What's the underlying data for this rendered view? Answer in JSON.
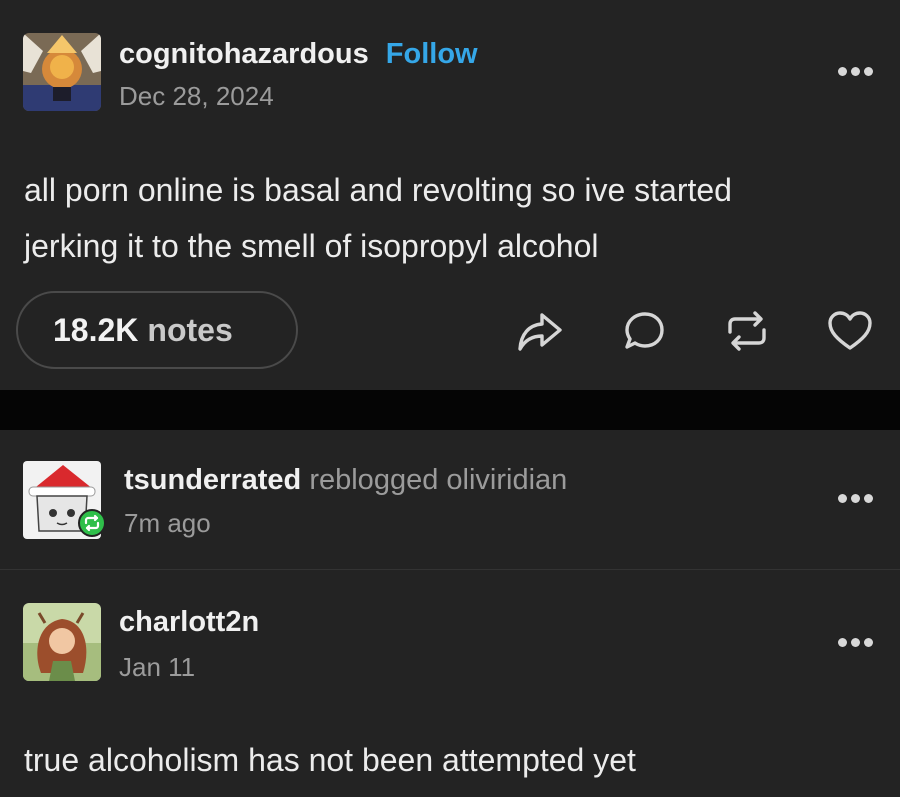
{
  "post1": {
    "username": "cognitohazardous",
    "follow_label": "Follow",
    "date": "Dec 28, 2024",
    "body_lines": [
      "all porn online is basal and revolting so ive started",
      "jerking it to the smell of isopropyl alcohol"
    ],
    "notes_count": "18.2K",
    "notes_label": "notes",
    "actions": [
      "share-icon",
      "reply-icon",
      "reblog-icon",
      "like-icon"
    ]
  },
  "reblog_header": {
    "username": "tsunderrated",
    "action": "reblogged",
    "source": "oliviridian",
    "time": "7m ago"
  },
  "post2": {
    "username": "charlott2n",
    "date": "Jan 11",
    "body": "true alcoholism has not been attempted yet"
  },
  "colors": {
    "background": "#232323",
    "separator": "#050505",
    "follow": "#35a7e8",
    "reblog_badge": "#2fbf4a"
  }
}
